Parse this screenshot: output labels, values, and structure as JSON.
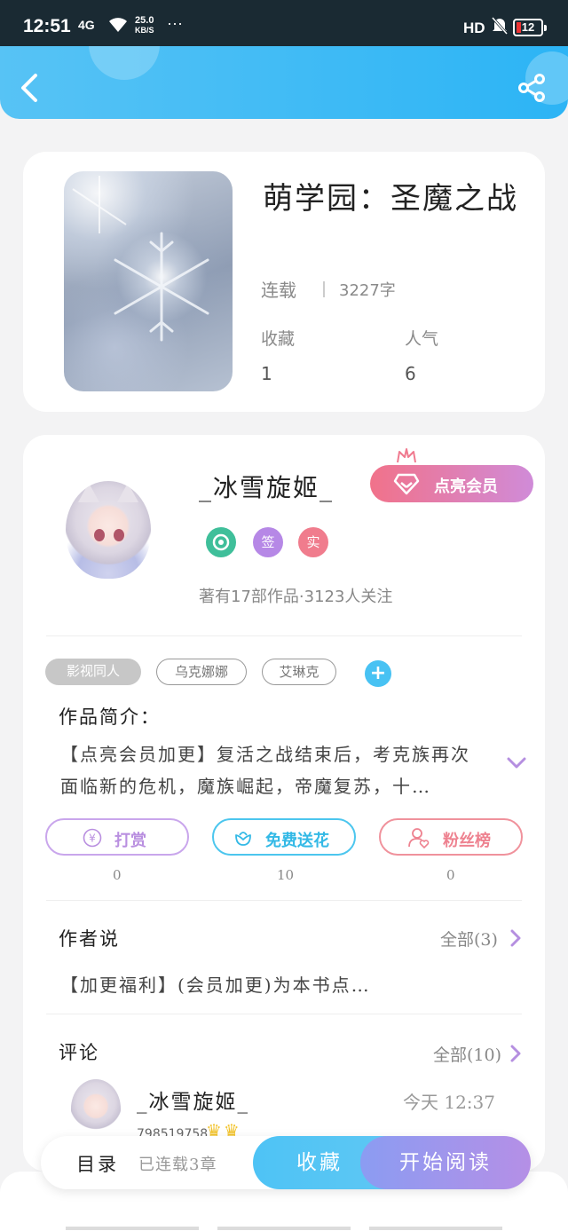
{
  "status_bar": {
    "time": "12:51",
    "signal": "4G",
    "speed_value": "25.0",
    "speed_unit": "KB/S",
    "more": "···",
    "hd": "HD",
    "battery": "12"
  },
  "header": {
    "back_icon": "chevron-left-icon",
    "share_icon": "share-icon",
    "color": "#2cb4f5"
  },
  "book": {
    "title": "萌学园：圣魔之战",
    "status": "连载",
    "words": "3227字",
    "stats": [
      {
        "label": "收藏",
        "value": "1"
      },
      {
        "label": "人气",
        "value": "6"
      }
    ]
  },
  "author": {
    "name": "_冰雪旋姬_",
    "vip_button": "点亮会员",
    "badges": [
      "flower-badge",
      "签",
      "实"
    ],
    "stats_text": "著有17部作品·3123人关注"
  },
  "tags": [
    "影视同人",
    "乌克娜娜",
    "艾琳克"
  ],
  "intro": {
    "title": "作品简介：",
    "text": "【点亮会员加更】复活之战结束后，考克族再次面临新的危机，魔族崛起，帝魔复苏，十…"
  },
  "actions": [
    {
      "label": "打赏",
      "count": "0",
      "icon": "yen-icon",
      "color": "#b98fe0"
    },
    {
      "label": "免费送花",
      "count": "10",
      "icon": "flower-icon",
      "color": "#3fc0ea"
    },
    {
      "label": "粉丝榜",
      "count": "0",
      "icon": "fans-icon",
      "color": "#ee8290"
    }
  ],
  "author_note": {
    "title": "作者说",
    "all": "全部(3)",
    "text": "【加更福利】(会员加更)为本书点…"
  },
  "comments": {
    "title": "评论",
    "all": "全部(10)",
    "items": [
      {
        "name": "_冰雪旋姬_",
        "time": "今天 12:37",
        "id": "798519758"
      }
    ]
  },
  "bottom_bar": {
    "toc": "目录",
    "chapters": "已连载3章",
    "favorite": "收藏",
    "read": "开始阅读"
  }
}
